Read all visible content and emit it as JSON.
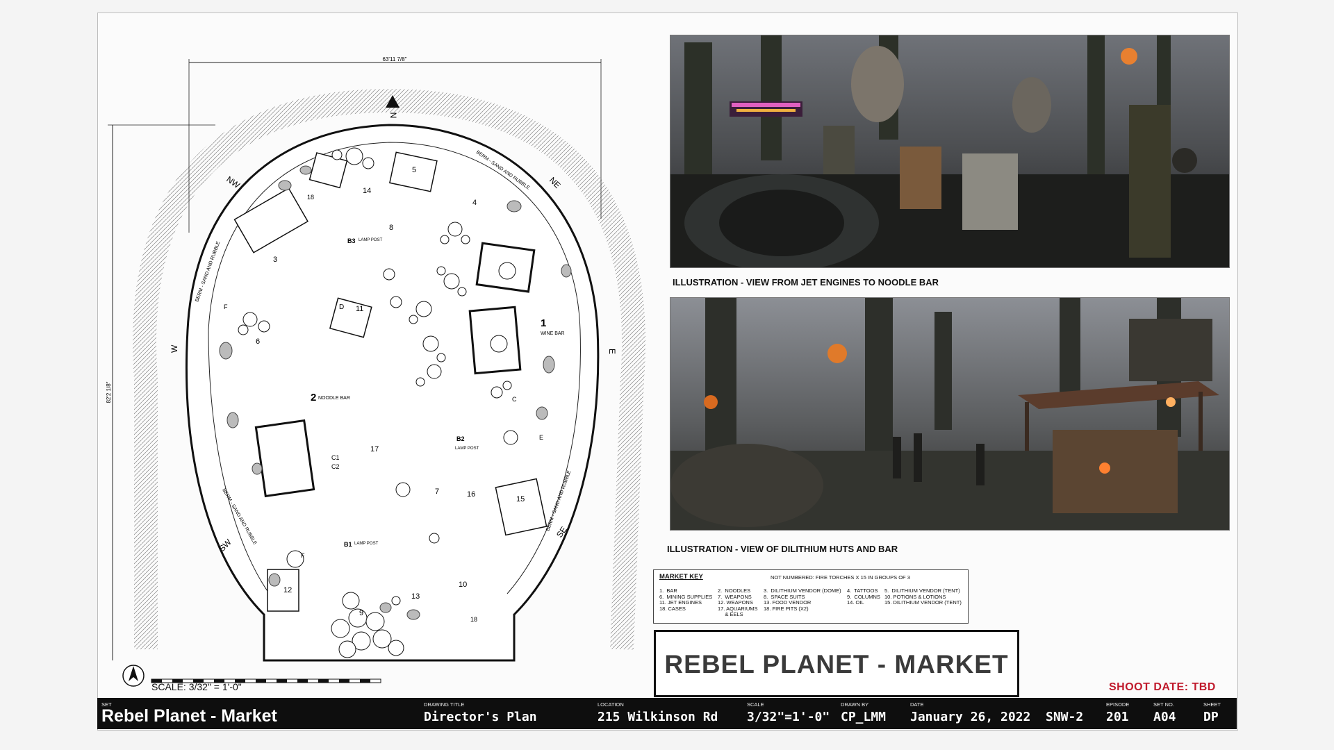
{
  "plan": {
    "dim_top": "63'11 7/8\"",
    "dim_side": "82'2 1/8\"",
    "compass": [
      "N",
      "NE",
      "E",
      "SE",
      "SW",
      "W",
      "NW"
    ],
    "berm_label": "BERM - SAND AND RUBBLE",
    "areas": [
      {
        "num": "1",
        "label": "WINE BAR"
      },
      {
        "num": "2",
        "label": "NOODLE BAR"
      }
    ],
    "lamp_posts": [
      "B1",
      "B2",
      "B3"
    ],
    "lamp_post_label": "LAMP POST",
    "markers": [
      "C",
      "D",
      "E",
      "F",
      "C1",
      "C2"
    ],
    "numbers": [
      "3",
      "4",
      "5",
      "6",
      "7",
      "8",
      "9",
      "10",
      "11",
      "12",
      "13",
      "14",
      "15",
      "16",
      "17",
      "18"
    ],
    "scale": "SCALE: 3/32\" = 1'-0\""
  },
  "photos": [
    {
      "caption": "ILLUSTRATION - VIEW FROM JET ENGINES TO NOODLE BAR"
    },
    {
      "caption": "ILLUSTRATION - VIEW OF DILITHIUM HUTS AND BAR"
    }
  ],
  "market_key": {
    "title": "MARKET KEY",
    "note": "NOT NUMBERED: FIRE TORCHES X 15 IN GROUPS OF 3",
    "columns": [
      "1.  BAR\n6.  MINING SUPPLIES\n11. JET ENGINES\n18. CASES",
      "2.  NOODLES\n7.  WEAPONS\n12. WEAPONS\n17. AQUARIUMS\n     & EELS",
      "3.  DILITHIUM VENDOR (DOME)\n8.  SPACE SUITS\n13. FOOD VENDOR\n18. FIRE PITS (X2)",
      "4.  TATTOOS\n9.  COLUMNS\n14. OIL",
      "5.  DILITHIUM VENDOR (TENT)\n10. POTIONS & LOTIONS\n15. DILITHIUM VENDOR (TENT)"
    ]
  },
  "title_box": "REBEL PLANET - MARKET",
  "shoot_date": "SHOOT DATE: TBD",
  "title_block": {
    "set_label": "SET",
    "set_value": "Rebel Planet - Market",
    "drawing_label": "DRAWING TITLE",
    "drawing_value": "Director's Plan",
    "location_label": "LOCATION",
    "location_value": "215 Wilkinson Rd",
    "scale_label": "SCALE",
    "scale_value": "3/32\"=1'-0\"",
    "drawn_label": "DRAWN BY",
    "drawn_value": "CP_LMM",
    "date_label": "DATE",
    "date_value": "January 26, 2022",
    "code_value": "SNW-2",
    "episode_label": "EPISODE",
    "episode_value": "201",
    "setno_label": "SET NO.",
    "setno_value": "A04",
    "sheet_label": "SHEET",
    "sheet_value": "DP"
  },
  "colors": {
    "shoot_date": "#c01a2c",
    "title_block_bg": "#0e0e0e"
  }
}
